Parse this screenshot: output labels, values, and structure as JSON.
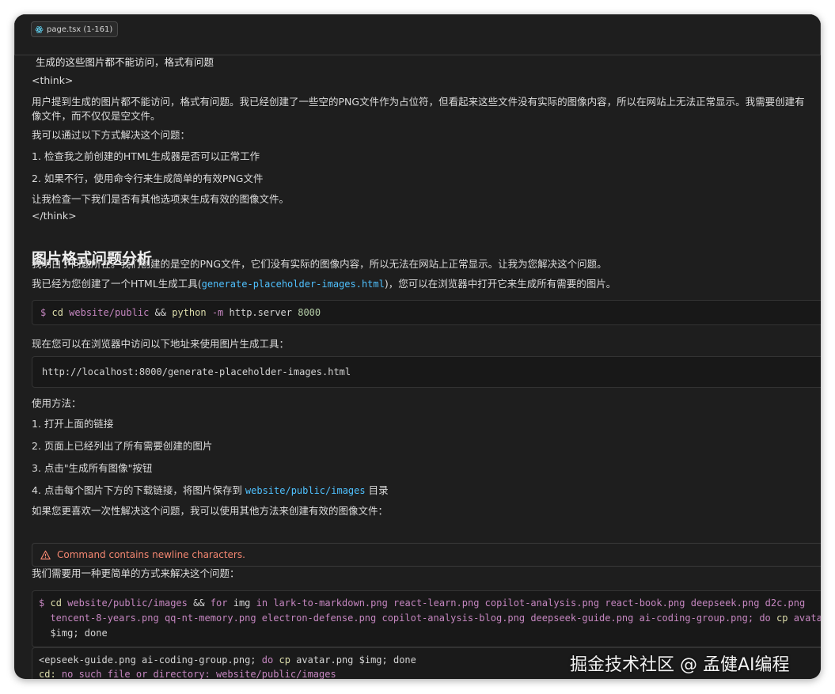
{
  "context": {
    "file_chip": "page.tsx (1-161)",
    "user_message": "生成的这些图片都不能访问，格式有问题"
  },
  "think": {
    "open_tag": "<think>",
    "line1a": "用户提到生成的图片都不能访问，格式有问题。我已经创建了一些空的PNG文件作为占位符，但看起来这些文件没有实际的图像内容，所以在网站上无法正常显示。我需要创建有",
    "line1b": "像文件，而不仅仅是空文件。",
    "line2": "我可以通过以下方式解决这个问题：",
    "line3": "1. 检查我之前创建的HTML生成器是否可以正常工作",
    "line4": "2. 如果不行，使用命令行来生成简单的有效PNG文件",
    "line5": "让我检查一下我们是否有其他选项来生成有效的图像文件。",
    "close_tag": "</think>"
  },
  "analysis": {
    "heading": "图片格式问题分析",
    "p1": "我明白了问题所在。我们创建的是空的PNG文件，它们没有实际的图像内容，所以无法在网站上正常显示。让我为您解决这个问题。",
    "p2_pre": "我已经为您创建了一个HTML生成工具(",
    "p2_code": "generate-placeholder-images.html",
    "p2_post": ")，您可以在浏览器中打开它来生成所有需要的图片。"
  },
  "cmd1": {
    "prompt": "$",
    "cmd": "cd",
    "arg1": "website/public",
    "op": "&&",
    "cmd2": "python",
    "arg2": "-m",
    "arg3": "http.server",
    "port": "8000"
  },
  "visit_text": "现在您可以在浏览器中访问以下地址来使用图片生成工具：",
  "url_block": "http://localhost:8000/generate-placeholder-images.html",
  "usage": {
    "title": "使用方法：",
    "s1": "1. 打开上面的链接",
    "s2": "2. 页面上已经列出了所有需要创建的图片",
    "s3": "3. 点击\"生成所有图像\"按钮",
    "s4_pre": "4. 点击每个图片下方的下载链接，将图片保存到",
    "s4_code": "website/public/images",
    "s4_post": "目录",
    "alt": "如果您更喜欢一次性解决这个问题，我可以使用其他方法来创建有效的图像文件："
  },
  "warning": {
    "icon": "warning-icon",
    "text": "Command contains newline characters."
  },
  "simpler_text": "我们需要用一种更简单的方式来解决这个问题：",
  "cmd2": {
    "prompt": "$",
    "cd": "cd",
    "dir": "website/public/images",
    "and": "&&",
    "for": "for",
    "var": "img",
    "in": "in",
    "files_line1": "lark-to-markdown.png react-learn.png copilot-analysis.png react-book.png deepseek.png d2c.png",
    "files_line2": "tencent-8-years.png qq-nt-memory.png electron-defense.png copilot-analysis-blog.png deepseek-guide.png ai-coding-group.png;",
    "do": "do",
    "cp": "cp",
    "avatar": "avatar.p",
    "tail": "$img; done"
  },
  "output": {
    "line1_pre": "<epseek-guide.png ai-coding-group.png;",
    "line1_do": "do",
    "line1_cp": "cp",
    "line1_post": "avatar.png $img; done",
    "line2_cmd": "cd:",
    "line2_msg": "no such file or directory: website/public/images"
  },
  "watermark": "掘金技术社区 @ 孟健AI编程"
}
